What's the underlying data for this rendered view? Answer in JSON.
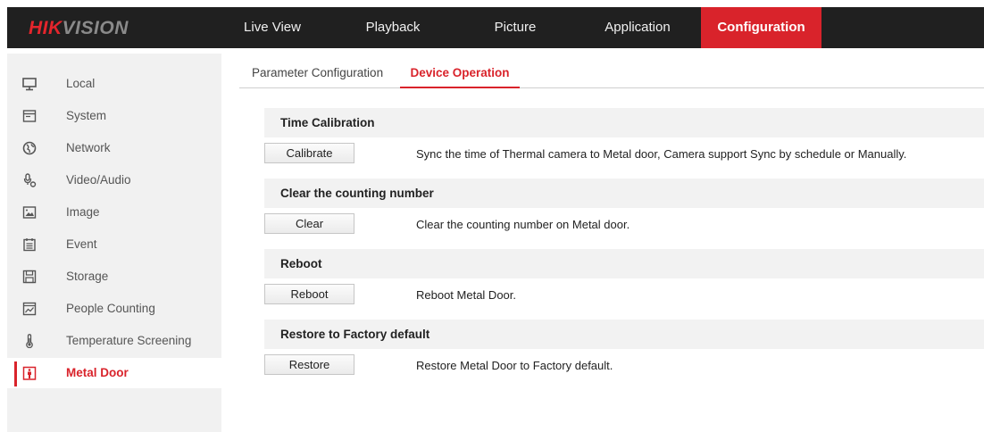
{
  "brand": {
    "part1": "HIK",
    "part2": "VISION"
  },
  "nav": [
    {
      "label": "Live View"
    },
    {
      "label": "Playback"
    },
    {
      "label": "Picture"
    },
    {
      "label": "Application"
    },
    {
      "label": "Configuration",
      "active": true
    }
  ],
  "sidebar": {
    "items": [
      {
        "label": "Local",
        "icon": "monitor-icon"
      },
      {
        "label": "System",
        "icon": "window-icon"
      },
      {
        "label": "Network",
        "icon": "globe-icon"
      },
      {
        "label": "Video/Audio",
        "icon": "microphone-icon"
      },
      {
        "label": "Image",
        "icon": "image-icon"
      },
      {
        "label": "Event",
        "icon": "calendar-icon"
      },
      {
        "label": "Storage",
        "icon": "disk-icon"
      },
      {
        "label": "People Counting",
        "icon": "chart-icon"
      },
      {
        "label": "Temperature Screening",
        "icon": "thermometer-icon"
      },
      {
        "label": "Metal Door",
        "icon": "metal-door-icon",
        "active": true
      }
    ]
  },
  "tabs": [
    {
      "label": "Parameter Configuration"
    },
    {
      "label": "Device Operation",
      "active": true
    }
  ],
  "sections": [
    {
      "title": "Time Calibration",
      "button": "Calibrate",
      "description": "Sync the time of Thermal camera to Metal door, Camera support Sync by schedule or Manually."
    },
    {
      "title": "Clear the counting number",
      "button": "Clear",
      "description": "Clear the counting number on Metal door."
    },
    {
      "title": "Reboot",
      "button": "Reboot",
      "description": "Reboot Metal Door."
    },
    {
      "title": "Restore to Factory default",
      "button": "Restore",
      "description": "Restore Metal Door to Factory default."
    }
  ],
  "colors": {
    "accent": "#d9232b",
    "topbar": "#202020",
    "sidebar": "#f1f1f1",
    "section_header": "#f2f2f2"
  }
}
